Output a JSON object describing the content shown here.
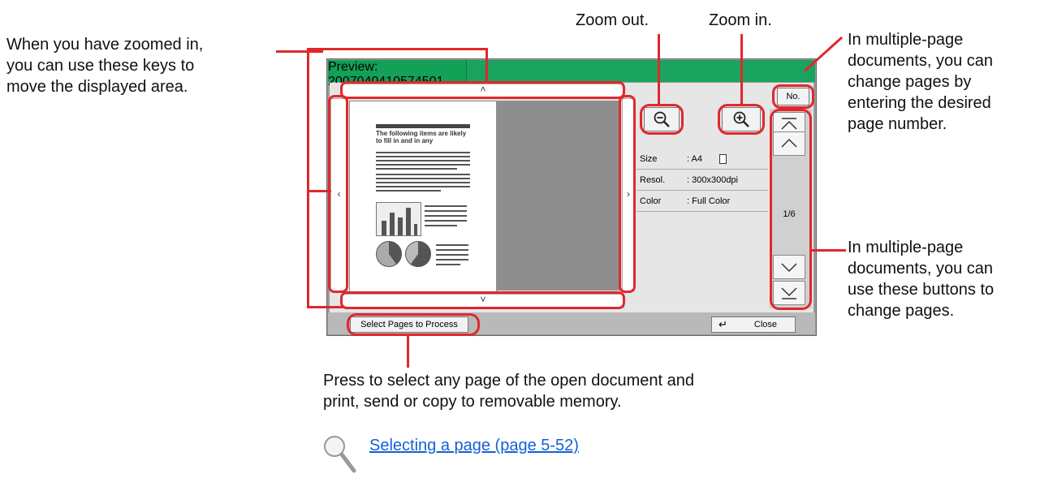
{
  "screen": {
    "preview_label": "Preview:",
    "file_name": "2007040410574501",
    "no_button": "No.",
    "select_pages_button": "Select Pages to Process",
    "close_button": "Close",
    "page_indicator": "1/6",
    "info": [
      {
        "key": "Size",
        "value": ": A4"
      },
      {
        "key": "Resol.",
        "value": ": 300x300dpi"
      },
      {
        "key": "Color",
        "value": ": Full Color"
      }
    ],
    "doc_heading": "The following items are likely to fill in and in any"
  },
  "callouts": {
    "zoom_out": "Zoom out.",
    "zoom_in": "Zoom in.",
    "move_area": [
      "When you have zoomed in,",
      "you can use these keys to",
      "move the displayed area."
    ],
    "page_number": [
      "In multiple-page",
      "documents, you can",
      "change pages by",
      "entering the desired",
      "page number."
    ],
    "page_buttons": [
      "In multiple-page",
      "documents, you can",
      "use these buttons to",
      "change pages."
    ],
    "select_pages": [
      "Press to select any page of the open document and",
      "print, send or copy to removable memory."
    ]
  },
  "tip": {
    "link_text": "Selecting a page (page 5-52)"
  },
  "colors": {
    "accent_green": "#1aa35e",
    "callout_red": "#e0282c",
    "link_blue": "#1560d6"
  }
}
